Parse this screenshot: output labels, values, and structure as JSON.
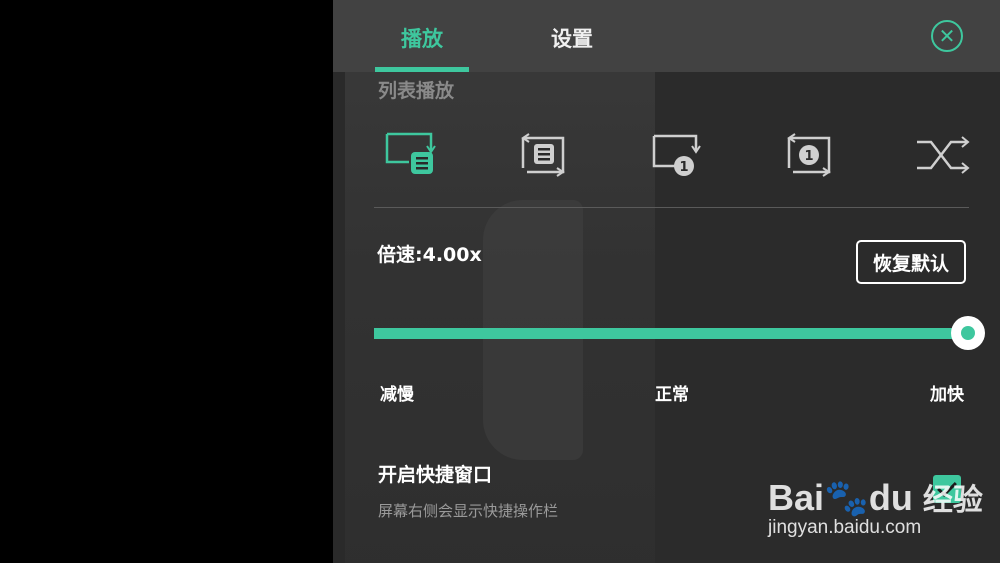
{
  "tabs": [
    {
      "label": "播放",
      "active": true
    },
    {
      "label": "设置",
      "active": false
    }
  ],
  "playlist": {
    "title": "列表播放",
    "modes": [
      {
        "icon": "list-loop-icon",
        "active": true
      },
      {
        "icon": "list-repeat-icon",
        "active": false
      },
      {
        "icon": "single-play-icon",
        "badge": "1",
        "active": false
      },
      {
        "icon": "single-repeat-icon",
        "badge": "1",
        "active": false
      },
      {
        "icon": "shuffle-icon",
        "active": false
      }
    ]
  },
  "speed": {
    "label": "倍速:4.00x",
    "reset_label": "恢复默认",
    "level": 1.0,
    "ticks": {
      "slow": "减慢",
      "normal": "正常",
      "fast": "加快"
    }
  },
  "shortcut": {
    "title": "开启快捷窗口",
    "subtitle": "屏幕右侧会显示快捷操作栏",
    "checked": true
  },
  "watermark": {
    "brand": "Bai",
    "brand2": "du",
    "jingyan": "经验",
    "url": "jingyan.baidu.com"
  },
  "colors": {
    "accent": "#3ec79e",
    "panel": "#2a2a2a",
    "header": "#424242"
  }
}
